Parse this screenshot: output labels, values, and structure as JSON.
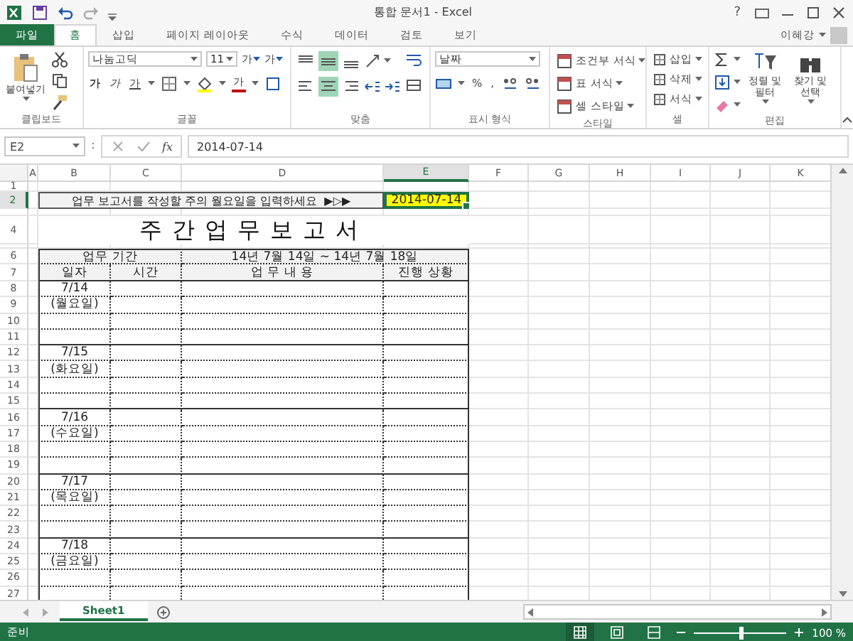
{
  "window": {
    "title": "통합 문서1 - Excel",
    "help": "?",
    "user": "이혜강"
  },
  "ribbon_tabs": [
    {
      "label": "파일",
      "kind": "file",
      "selected": false
    },
    {
      "label": "홈",
      "kind": "tab",
      "selected": true
    },
    {
      "label": "삽입",
      "kind": "tab",
      "selected": false
    },
    {
      "label": "페이지 레이아웃",
      "kind": "tab",
      "selected": false
    },
    {
      "label": "수식",
      "kind": "tab",
      "selected": false
    },
    {
      "label": "데이터",
      "kind": "tab",
      "selected": false
    },
    {
      "label": "검토",
      "kind": "tab",
      "selected": false
    },
    {
      "label": "보기",
      "kind": "tab",
      "selected": false
    }
  ],
  "ribbon": {
    "clipboard": {
      "label": "클립보드",
      "paste": "붙여넣기"
    },
    "font": {
      "label": "글꼴",
      "font_name": "나눔고딕",
      "font_size": "11",
      "grow": "가",
      "shrink": "가",
      "styles": [
        {
          "kind": "bold",
          "label": "가"
        },
        {
          "kind": "italic",
          "label": "가"
        },
        {
          "kind": "underline",
          "label": "가"
        }
      ],
      "font_color": "가"
    },
    "alignment": {
      "label": "맞춤",
      "vertical": [
        {
          "kind": "top",
          "selected": false
        },
        {
          "kind": "middle",
          "selected": true
        },
        {
          "kind": "bottom",
          "selected": false
        }
      ],
      "horizontal": [
        {
          "kind": "left",
          "selected": false
        },
        {
          "kind": "center",
          "selected": true
        },
        {
          "kind": "right",
          "selected": false
        }
      ]
    },
    "number": {
      "label": "표시 형식",
      "format": "날짜",
      "percent": "%",
      "comma": ","
    },
    "styles": {
      "label": "스타일",
      "items": [
        "조건부 서식",
        "표 서식",
        "셀 스타일"
      ]
    },
    "cells": {
      "label": "셀",
      "items": [
        "삽입",
        "삭제",
        "서식"
      ]
    },
    "editing": {
      "label": "편집",
      "sort": "정렬 및 필터",
      "find": "찾기 및 선택"
    }
  },
  "formula_bar": {
    "name_box": "E2",
    "function_label": "fx",
    "formula": "2014-07-14"
  },
  "columns": [
    {
      "label": "A",
      "selected": false
    },
    {
      "label": "B",
      "selected": false
    },
    {
      "label": "C",
      "selected": false
    },
    {
      "label": "D",
      "selected": false
    },
    {
      "label": "E",
      "selected": true
    },
    {
      "label": "F",
      "selected": false
    },
    {
      "label": "G",
      "selected": false
    },
    {
      "label": "H",
      "selected": false
    },
    {
      "label": "I",
      "selected": false
    },
    {
      "label": "J",
      "selected": false
    },
    {
      "label": "K",
      "selected": false
    }
  ],
  "rows": [
    {
      "label": "1",
      "selected": false
    },
    {
      "label": "2",
      "selected": true
    },
    {
      "selected": false
    },
    {
      "label": "4",
      "selected": false
    },
    {
      "selected": false
    },
    {
      "label": "6",
      "selected": false
    },
    {
      "label": "7",
      "selected": false
    },
    {
      "label": "8",
      "selected": false
    },
    {
      "label": "9",
      "selected": false
    },
    {
      "label": "10",
      "selected": false
    },
    {
      "label": "11",
      "selected": false
    },
    {
      "label": "12",
      "selected": false
    },
    {
      "label": "13",
      "selected": false
    },
    {
      "label": "14",
      "selected": false
    },
    {
      "label": "15",
      "selected": false
    },
    {
      "label": "16",
      "selected": false
    },
    {
      "label": "17",
      "selected": false
    },
    {
      "label": "18",
      "selected": false
    },
    {
      "label": "19",
      "selected": false
    },
    {
      "label": "20",
      "selected": false
    },
    {
      "label": "21",
      "selected": false
    },
    {
      "label": "22",
      "selected": false
    },
    {
      "label": "23",
      "selected": false
    },
    {
      "label": "24",
      "selected": false
    },
    {
      "label": "25",
      "selected": false
    },
    {
      "label": "26",
      "selected": false
    },
    {
      "label": "27",
      "selected": false
    }
  ],
  "sheet": {
    "instruction": "업무 보고서를 작성할 주의 월요일을 입력하세요  ▶▷▶",
    "date_input": "2014-07-14",
    "title": "주간업무보고서",
    "period_label": "업무 기간",
    "period": "14년 7월 14일 ~ 14년 7월 18일",
    "headers": [
      "일자",
      "시간",
      "업 무 내 용",
      "진행 상황"
    ],
    "days": [
      {
        "date": "7/14",
        "weekday": "(월요일)"
      },
      {
        "date": "7/15",
        "weekday": "(화요일)"
      },
      {
        "date": "7/16",
        "weekday": "(수요일)"
      },
      {
        "date": "7/17",
        "weekday": "(목요일)"
      },
      {
        "date": "7/18",
        "weekday": "(금요일)"
      }
    ]
  },
  "sheet_tabs": [
    {
      "label": "Sheet1",
      "selected": true
    }
  ],
  "status_bar": {
    "status": "준비",
    "view_modes": [
      {
        "kind": "normal",
        "selected": true
      },
      {
        "kind": "page_layout",
        "selected": false
      },
      {
        "kind": "page_break",
        "selected": false
      }
    ],
    "zoom": {
      "level": 0.5
    },
    "zoom_label": "100 %"
  }
}
